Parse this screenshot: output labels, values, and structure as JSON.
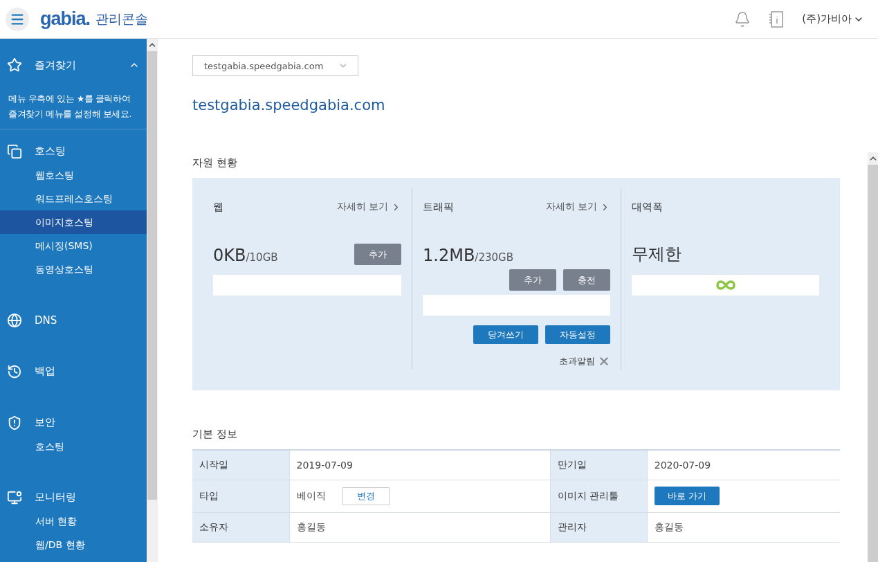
{
  "header": {
    "logo": "gabia.",
    "title": "관리콘솔",
    "user": "(주)가비아"
  },
  "sidebar": {
    "favorites": {
      "label": "즐겨찾기",
      "expanded": true,
      "hint": "메뉴 우측에 있는 ★를 클릭하여 즐겨찾기 메뉴를 설정해 보세요."
    },
    "groups": [
      {
        "kind": "hosting",
        "label": "호스팅",
        "items": [
          {
            "label": "웹호스팅",
            "selected": false
          },
          {
            "label": "워드프레스호스팅",
            "selected": false
          },
          {
            "label": "이미지호스팅",
            "selected": true
          },
          {
            "label": "메시징(SMS)",
            "selected": false
          },
          {
            "label": "동영상호스팅",
            "selected": false
          }
        ]
      },
      {
        "kind": "dns",
        "label": "DNS"
      },
      {
        "kind": "backup",
        "label": "백업"
      },
      {
        "kind": "security",
        "label": "보안",
        "items": [
          {
            "label": "호스팅",
            "selected": false
          }
        ]
      },
      {
        "kind": "monitoring",
        "label": "모니터링",
        "items": [
          {
            "label": "서버 현황",
            "selected": false
          },
          {
            "label": "웹/DB 현황",
            "selected": false
          }
        ]
      }
    ]
  },
  "domain_select": {
    "value": "testgabia.speedgabia.com"
  },
  "domain_title": "testgabia.speedgabia.com",
  "resources": {
    "title": "자원 현황",
    "cards": [
      {
        "kind": "web",
        "title": "웹",
        "detail_link": "자세히 보기",
        "used": "0KB",
        "total": "/10GB",
        "top_buttons": [
          "추가"
        ]
      },
      {
        "kind": "traffic",
        "title": "트래픽",
        "detail_link": "자세히 보기",
        "used": "1.2MB",
        "total": "/230GB",
        "top_buttons": [
          "추가",
          "충전"
        ],
        "bottom_buttons": [
          "당겨쓰기",
          "자동설정"
        ],
        "alert": "초과알림"
      },
      {
        "kind": "bandwidth",
        "title": "대역폭",
        "used": "무제한"
      }
    ]
  },
  "basic_info": {
    "title": "기본 정보",
    "rows": [
      [
        {
          "label": "시작일",
          "value": "2019-07-09"
        },
        {
          "label": "만기일",
          "value": "2020-07-09"
        }
      ],
      [
        {
          "label": "타입",
          "value": "베이직",
          "button": "변경"
        },
        {
          "label": "이미지 관리툴",
          "action": "바로 가기"
        }
      ],
      [
        {
          "label": "소유자",
          "value": "홍길동"
        },
        {
          "label": "관리자",
          "value": "홍길동"
        }
      ]
    ]
  }
}
